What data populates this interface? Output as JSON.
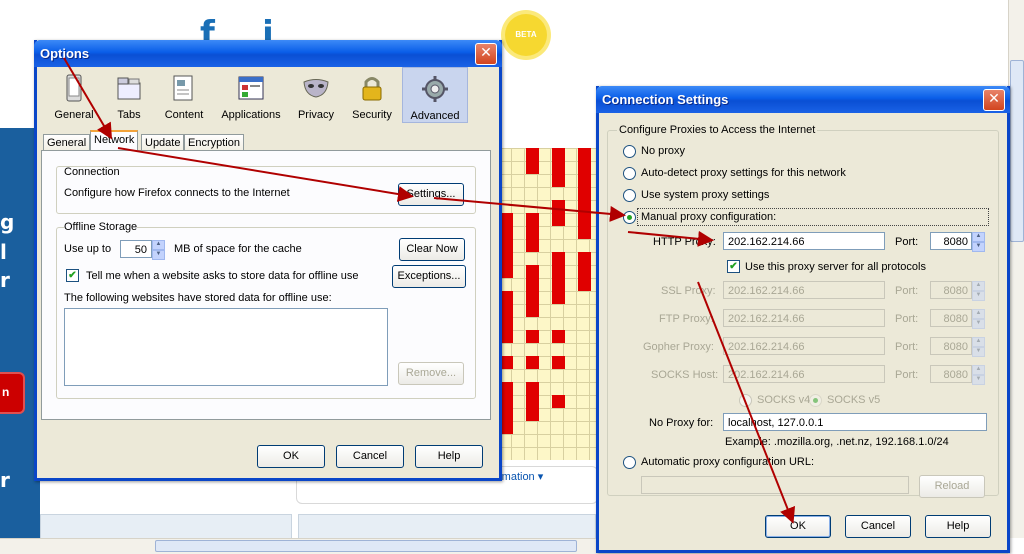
{
  "options": {
    "title": "Options",
    "close": "✕",
    "toolbar": [
      {
        "label": "General",
        "icon": "general-icon"
      },
      {
        "label": "Tabs",
        "icon": "tabs-icon"
      },
      {
        "label": "Content",
        "icon": "content-icon"
      },
      {
        "label": "Applications",
        "icon": "applications-icon"
      },
      {
        "label": "Privacy",
        "icon": "privacy-icon"
      },
      {
        "label": "Security",
        "icon": "security-icon"
      },
      {
        "label": "Advanced",
        "icon": "advanced-icon"
      }
    ],
    "tabs": [
      "General",
      "Network",
      "Update",
      "Encryption"
    ],
    "connection": {
      "heading": "Connection",
      "text": "Configure how Firefox connects to the Internet",
      "settings_button": "Settings..."
    },
    "offline": {
      "heading": "Offline Storage",
      "use_up_to": "Use up to",
      "cache_value": "50",
      "cache_suffix": "MB of space for the cache",
      "clear_now": "Clear Now",
      "tell_me": "Tell me when a website asks to store data for offline use",
      "exceptions": "Exceptions...",
      "list_label": "The following websites have stored data for offline use:",
      "remove": "Remove..."
    },
    "buttons": {
      "ok": "OK",
      "cancel": "Cancel",
      "help": "Help"
    }
  },
  "connection_settings": {
    "title": "Connection Settings",
    "close": "✕",
    "group_label": "Configure Proxies to Access the Internet",
    "radio_no_proxy": "No proxy",
    "radio_auto_detect": "Auto-detect proxy settings for this network",
    "radio_system": "Use system proxy settings",
    "radio_manual": "Manual proxy configuration:",
    "http_proxy_label": "HTTP Proxy:",
    "http_proxy_value": "202.162.214.66",
    "port_label": "Port:",
    "http_port_value": "8080",
    "use_for_all": "Use this proxy server for all protocols",
    "ssl_label": "SSL Proxy:",
    "ftp_label": "FTP Proxy:",
    "gopher_label": "Gopher Proxy:",
    "socks_label": "SOCKS Host:",
    "ssl_value": "202.162.214.66",
    "ftp_value": "202.162.214.66",
    "gopher_value": "202.162.214.66",
    "socks_value": "202.162.214.66",
    "ssl_port": "8080",
    "ftp_port": "8080",
    "gopher_port": "8080",
    "socks_port": "8080",
    "socks_v4": "SOCKS v4",
    "socks_v5": "SOCKS v5",
    "no_proxy_label": "No Proxy for:",
    "no_proxy_value": "localhost, 127.0.0.1",
    "example": "Example: .mozilla.org, .net.nz, 192.168.1.0/24",
    "radio_auto_url": "Automatic proxy configuration URL:",
    "auto_url_value": "",
    "reload": "Reload",
    "buttons": {
      "ok": "OK",
      "cancel": "Cancel",
      "help": "Help"
    }
  },
  "background": {
    "beta_badge": "BETA",
    "link_text": "rmation ▾",
    "red_button": "n",
    "side_letters": [
      "g",
      "l",
      "r",
      "r"
    ]
  },
  "colors": {
    "annotation_arrow": "#b00000",
    "xp_title_blue": "#0a4fd4",
    "dialog_face": "#ece9d8"
  }
}
